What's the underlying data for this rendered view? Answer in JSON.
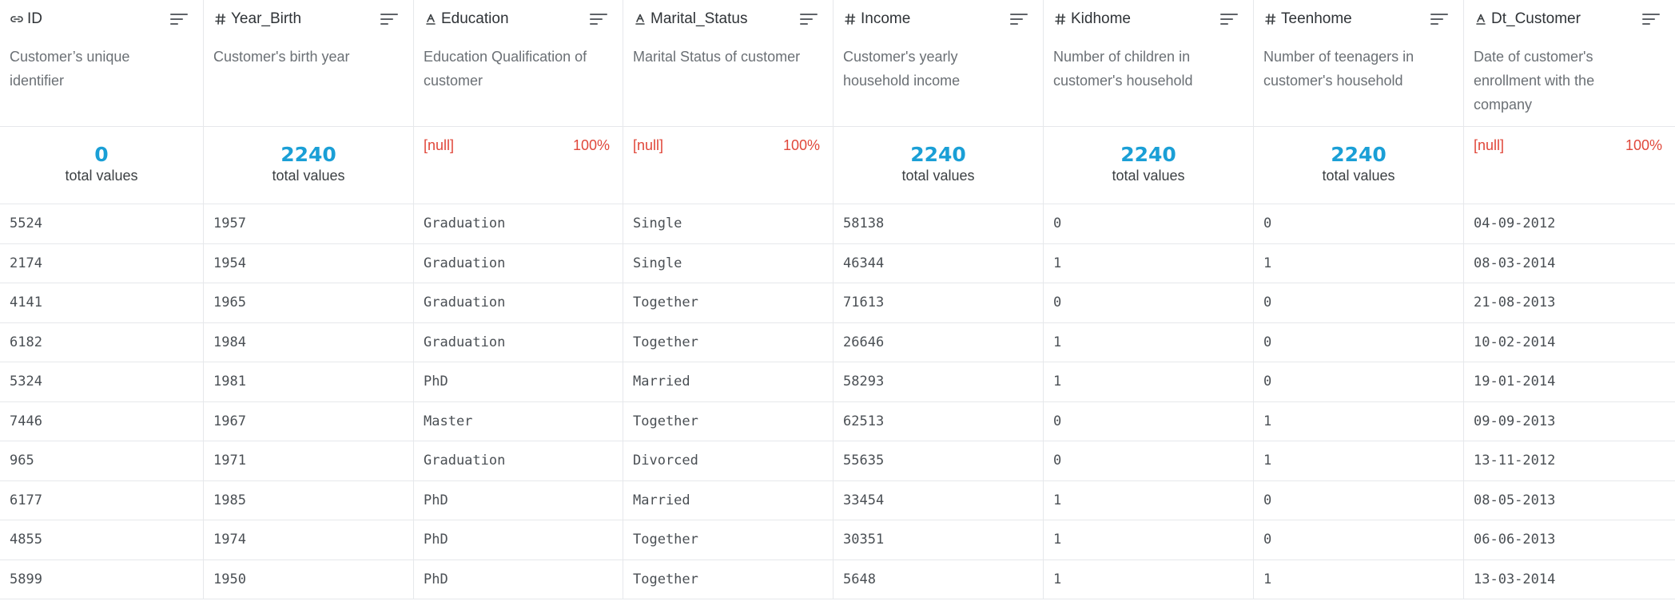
{
  "columns": [
    {
      "name": "ID",
      "type_icon": "link-icon",
      "description": "Customer’s unique identifier",
      "stat": {
        "kind": "count",
        "value": "0",
        "label": "total values"
      }
    },
    {
      "name": "Year_Birth",
      "type_icon": "hash-icon",
      "description": "Customer's birth year",
      "stat": {
        "kind": "count",
        "value": "2240",
        "label": "total values"
      }
    },
    {
      "name": "Education",
      "type_icon": "text-icon",
      "description": "Education Qualification of customer",
      "stat": {
        "kind": "null",
        "value": "[null]",
        "percent": "100%"
      }
    },
    {
      "name": "Marital_Status",
      "type_icon": "text-icon",
      "description": "Marital Status of customer",
      "stat": {
        "kind": "null",
        "value": "[null]",
        "percent": "100%"
      }
    },
    {
      "name": "Income",
      "type_icon": "hash-icon",
      "description": "Customer's yearly household income",
      "stat": {
        "kind": "count",
        "value": "2240",
        "label": "total values"
      }
    },
    {
      "name": "Kidhome",
      "type_icon": "hash-icon",
      "description": "Number of children in customer's household",
      "stat": {
        "kind": "count",
        "value": "2240",
        "label": "total values"
      }
    },
    {
      "name": "Teenhome",
      "type_icon": "hash-icon",
      "description": "Number of teenagers in customer's household",
      "stat": {
        "kind": "count",
        "value": "2240",
        "label": "total values"
      }
    },
    {
      "name": "Dt_Customer",
      "type_icon": "text-icon",
      "description": "Date of customer's enrollment with the company",
      "stat": {
        "kind": "null",
        "value": "[null]",
        "percent": "100%"
      }
    }
  ],
  "rows": [
    [
      "5524",
      "1957",
      "Graduation",
      "Single",
      "58138",
      "0",
      "0",
      "04-09-2012"
    ],
    [
      "2174",
      "1954",
      "Graduation",
      "Single",
      "46344",
      "1",
      "1",
      "08-03-2014"
    ],
    [
      "4141",
      "1965",
      "Graduation",
      "Together",
      "71613",
      "0",
      "0",
      "21-08-2013"
    ],
    [
      "6182",
      "1984",
      "Graduation",
      "Together",
      "26646",
      "1",
      "0",
      "10-02-2014"
    ],
    [
      "5324",
      "1981",
      "PhD",
      "Married",
      "58293",
      "1",
      "0",
      "19-01-2014"
    ],
    [
      "7446",
      "1967",
      "Master",
      "Together",
      "62513",
      "0",
      "1",
      "09-09-2013"
    ],
    [
      "965",
      "1971",
      "Graduation",
      "Divorced",
      "55635",
      "0",
      "1",
      "13-11-2012"
    ],
    [
      "6177",
      "1985",
      "PhD",
      "Married",
      "33454",
      "1",
      "0",
      "08-05-2013"
    ],
    [
      "4855",
      "1974",
      "PhD",
      "Together",
      "30351",
      "1",
      "0",
      "06-06-2013"
    ],
    [
      "5899",
      "1950",
      "PhD",
      "Together",
      "5648",
      "1",
      "1",
      "13-03-2014"
    ]
  ],
  "colors": {
    "accent": "#1a9fd6",
    "null": "#e0473a",
    "border": "#e6e8eb"
  }
}
